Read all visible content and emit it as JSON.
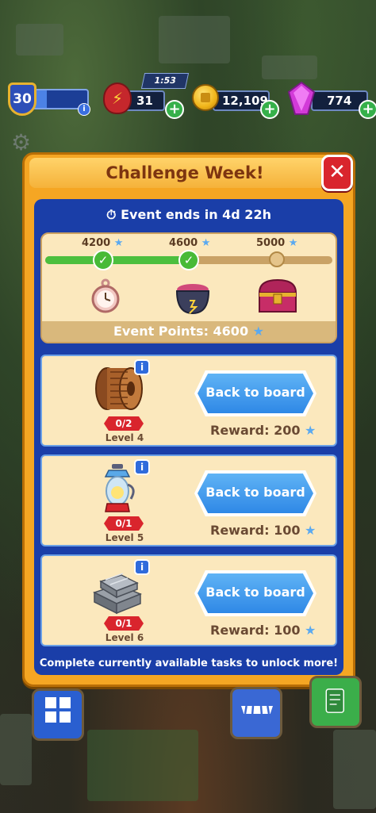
{
  "hud": {
    "level": "30",
    "xp_progress": 0.25,
    "energy": "31",
    "energy_timer": "1:53",
    "coins": "12,109",
    "gems": "774",
    "info_symbol": "i",
    "plus_symbol": "+"
  },
  "dialog": {
    "title": "Challenge Week!",
    "close_symbol": "✕",
    "event_timer": "Event ends in 4d 22h",
    "milestones": [
      {
        "points": "4200",
        "reward": "pocket-watch",
        "completed": true
      },
      {
        "points": "4600",
        "reward": "potion-cauldron",
        "completed": true
      },
      {
        "points": "5000",
        "reward": "treasure-chest",
        "completed": false
      }
    ],
    "progress_fraction": 0.51,
    "event_points_label": "Event Points: 4600",
    "tasks": [
      {
        "icon": "rope-spool",
        "progress": "0/2",
        "level": "Level 4",
        "button": "Back to board",
        "reward": "Reward: 200"
      },
      {
        "icon": "oil-lantern",
        "progress": "0/1",
        "level": "Level 5",
        "button": "Back to board",
        "reward": "Reward: 100"
      },
      {
        "icon": "iron-ingots",
        "progress": "0/1",
        "level": "Level 6",
        "button": "Back to board",
        "reward": "Reward: 100"
      }
    ],
    "footer": "Complete currently available tasks to unlock more!"
  },
  "colors": {
    "dialog_orange": "#f5a623",
    "inner_blue": "#1a3ea8",
    "card_cream": "#fbe8bd",
    "button_blue": "#2f88e6",
    "complete_green": "#4cbf3e",
    "badge_red": "#d9252d"
  }
}
